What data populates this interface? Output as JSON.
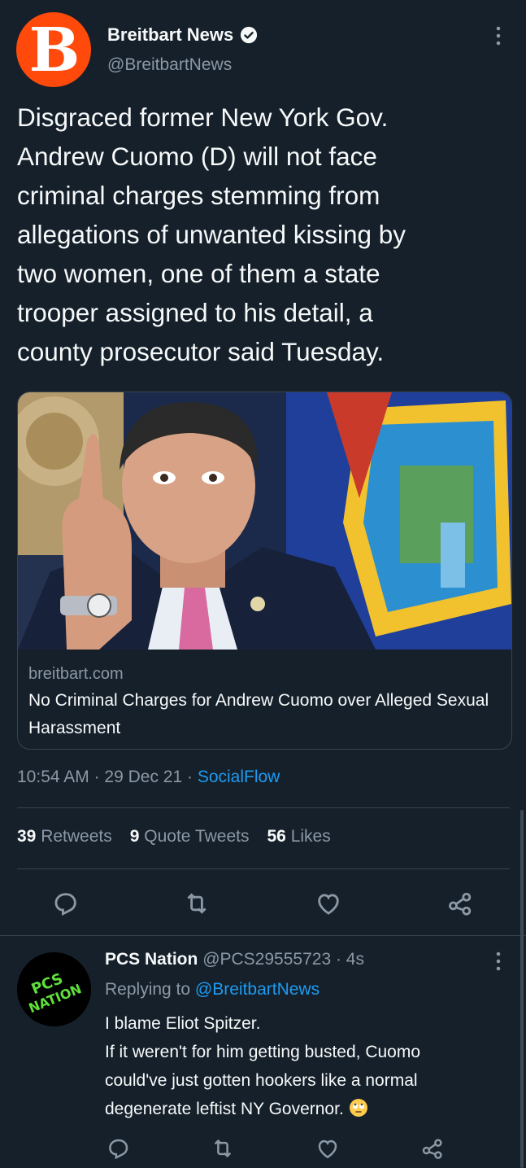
{
  "tweet": {
    "author": {
      "name": "Breitbart News",
      "handle": "@BreitbartNews",
      "avatar_letter": "B",
      "avatar_color": "#ff4a0b",
      "verified": true
    },
    "text_lines": [
      "Disgraced former New York Gov.",
      "Andrew Cuomo (D) will not face",
      "criminal charges stemming from",
      "allegations of unwanted kissing by",
      "two women, one of them a state",
      "trooper assigned to his detail, a",
      "county prosecutor said Tuesday."
    ],
    "card": {
      "domain": "breitbart.com",
      "title": "No Criminal Charges for Andrew Cuomo over Alleged Sexual Harassment",
      "image_alt": "Andrew Cuomo pointing upward in front of New York flag"
    },
    "time": "10:54 AM",
    "date": "29 Dec 21",
    "source": "SocialFlow",
    "stats": {
      "retweets_count": "39",
      "retweets_label": "Retweets",
      "quotes_count": "9",
      "quotes_label": "Quote Tweets",
      "likes_count": "56",
      "likes_label": "Likes"
    },
    "actions": [
      "reply-icon",
      "retweet-icon",
      "like-icon",
      "share-icon"
    ]
  },
  "reply": {
    "author": {
      "name": "PCS Nation",
      "handle": "@PCS29555723",
      "time": "4s",
      "avatar_text_1": "PCS",
      "avatar_text_2": "NATION"
    },
    "replying_label": "Replying to",
    "replying_to": "@BreitbartNews",
    "text_lines": [
      "I blame Eliot Spitzer.",
      "If it weren't for him getting busted, Cuomo",
      "could've just gotten hookers like a normal",
      "degenerate leftist NY Governor."
    ],
    "emoji": "face-with-rolling-eyes"
  },
  "colors": {
    "background": "#15202b",
    "text": "#f7f9f9",
    "muted": "#8b98a5",
    "link": "#1d9bf0",
    "border": "#38444d"
  }
}
